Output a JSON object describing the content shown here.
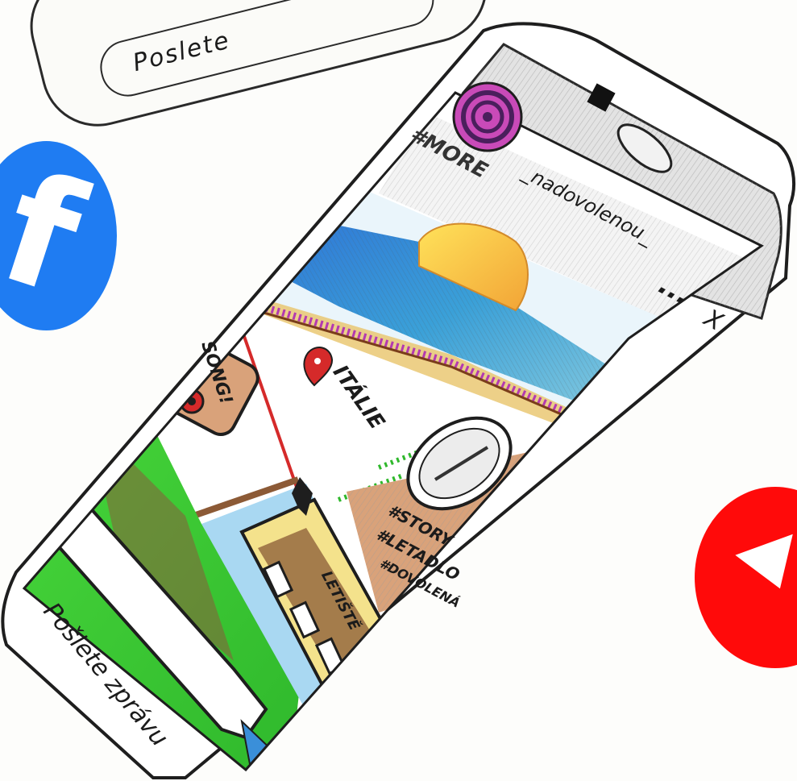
{
  "background_bubble": {
    "text": "Poslete"
  },
  "colors": {
    "facebook_blue": "#1f7cf2",
    "youtube_red": "#ff0a0a",
    "grass_green": "#3fd13a",
    "sky_blue": "#5aa7e8",
    "sun_yellow": "#f4cf3a",
    "phone_gray": "#cfcfcf"
  },
  "side_icons": {
    "left": "facebook-icon",
    "right": "youtube-icon"
  },
  "post": {
    "username": "_nadovolenou_",
    "hashtag_top": "#MORE",
    "menu_dots": "...",
    "close_symbol": "X",
    "location": "ITÁLIE",
    "music_sticker": "SONG!",
    "hashtags": [
      "#STORY",
      "#LETADLO",
      "#DOVOLENÁ"
    ],
    "bus_sign": "LETIŠTĚ"
  },
  "message_field": {
    "placeholder": "Pošlete zprávu"
  }
}
